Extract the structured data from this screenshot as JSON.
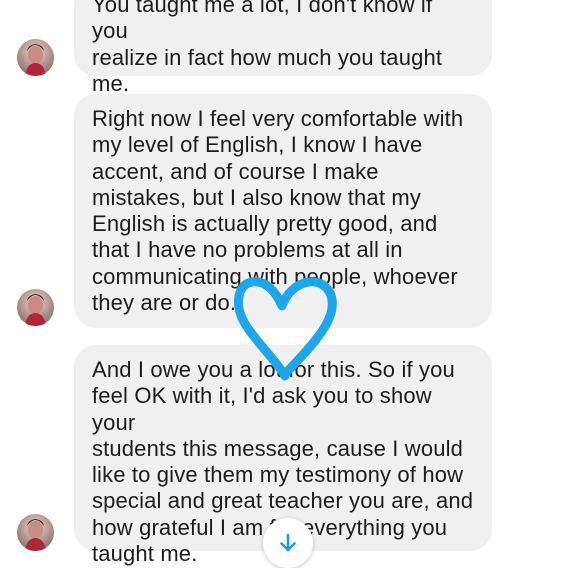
{
  "messages": [
    {
      "text": "You taught me a lot, I don't know if you\nrealize in fact how much you taught\nme."
    },
    {
      "text": "Right now I feel very comfortable with\nmy level of English, I know I have\naccent, and of course I make\nmistakes, but I also know  that my\nEnglish is actually pretty good, and\nthat I have no problems at all in\ncommunicating with people, whoever\nthey are or do."
    },
    {
      "text": "And I owe you a lot for this. So if you\nfeel OK with it, I'd ask you to show your\nstudents this message, cause I would\nlike to give them my testimony of how\nspecial and great teacher you are, and\nhow grateful I am for everything you\ntaught me."
    }
  ],
  "icons": {
    "scroll_down": "arrow-down-icon",
    "heart": "heart-drawing-icon",
    "avatar": "avatar-icon"
  },
  "colors": {
    "bubble_background": "#f0f0f0",
    "text": "#1c1c1c",
    "heart_stroke": "#1ea6e8",
    "accent": "#1e9be0"
  }
}
